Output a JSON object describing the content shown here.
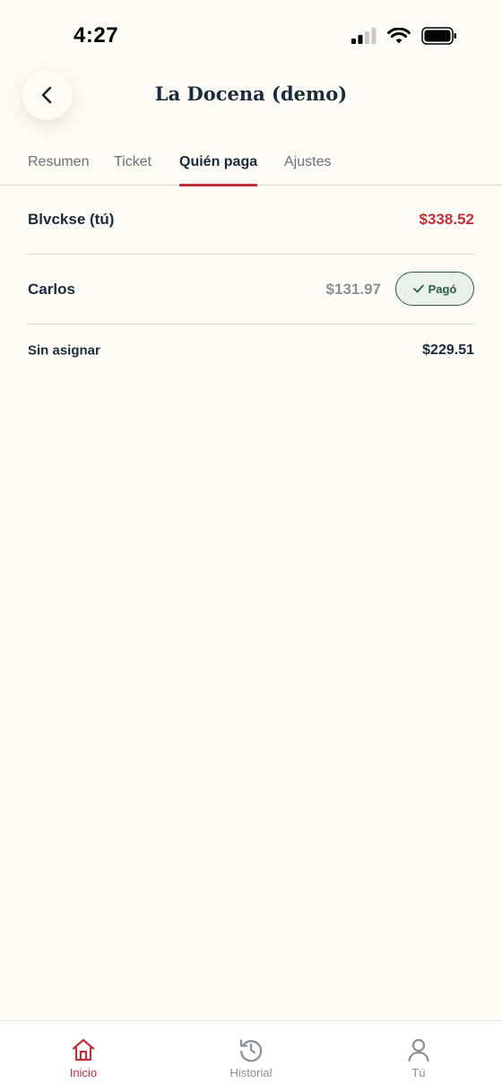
{
  "status_bar": {
    "time": "4:27"
  },
  "header": {
    "title": "La Docena (demo)"
  },
  "tabs": [
    {
      "label": "Resumen"
    },
    {
      "label": "Ticket"
    },
    {
      "label": "Quién paga",
      "active": true
    },
    {
      "label": "Ajustes"
    }
  ],
  "payers": [
    {
      "name": "Blvckse (tú)",
      "amount": "$338.52"
    },
    {
      "name": "Carlos",
      "amount": "$131.97",
      "badge": "Pagó"
    }
  ],
  "unassigned": {
    "label": "Sin asignar",
    "amount": "$229.51"
  },
  "tabbar": [
    {
      "label": "Inicio",
      "icon": "home-icon",
      "active": true
    },
    {
      "label": "Historial",
      "icon": "history-icon"
    },
    {
      "label": "Tú",
      "icon": "person-icon"
    }
  ],
  "colors": {
    "accent": "#c0303c",
    "background": "#fcfbf6",
    "text": "#1c2b3a",
    "paid": "#2e5a44"
  }
}
